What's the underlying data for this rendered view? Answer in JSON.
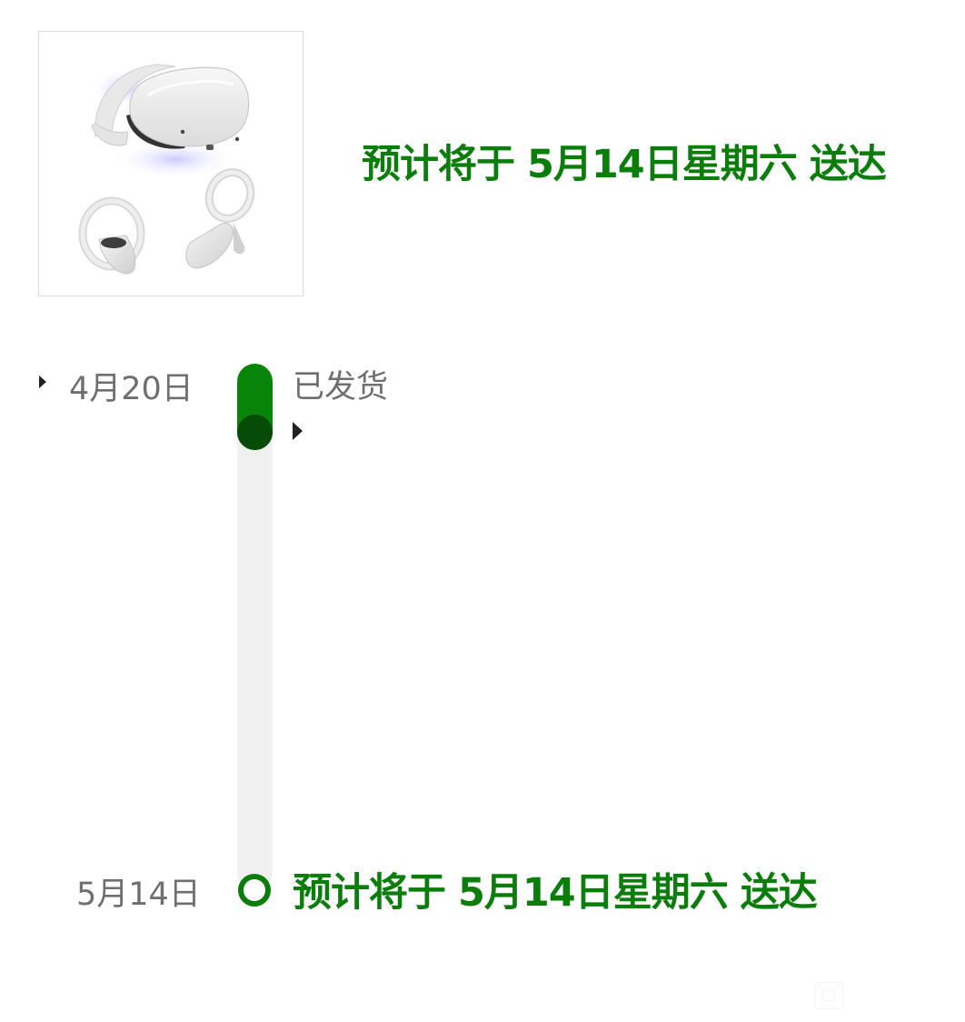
{
  "product": {
    "image_icon": "vr-headset-with-controllers-image"
  },
  "header": {
    "eta_text": "预计将于 5月14日星期六 送达"
  },
  "timeline": {
    "progress_fraction": 0.1,
    "start": {
      "date": "4月20日",
      "status": "已发货"
    },
    "end": {
      "date": "5月14日",
      "status": "预计将于 5月14日星期六 送达"
    }
  },
  "colors": {
    "accent_green": "#0a7d0a",
    "track_fill": "#088508",
    "knob_dark_green": "#064c06",
    "track_gray": "#f0f0f0",
    "muted_text": "#6f6f6f"
  },
  "icons": {
    "date_caret": "caret-right-icon",
    "event_caret": "caret-right-icon",
    "corner": "image-placeholder-icon"
  }
}
